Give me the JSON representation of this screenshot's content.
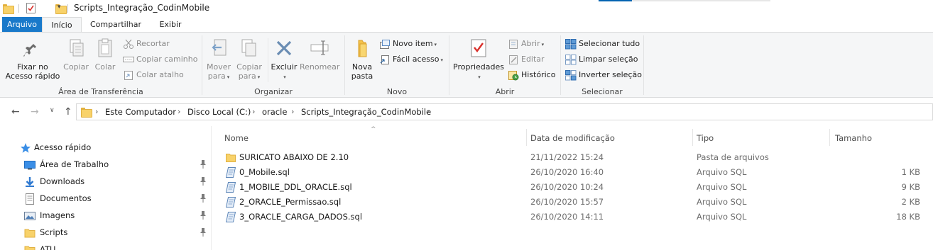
{
  "window": {
    "title": "Scripts_Integração_CodinMobile"
  },
  "ribbon_tabs": [
    {
      "label": "Arquivo"
    },
    {
      "label": "Início"
    },
    {
      "label": "Compartilhar"
    },
    {
      "label": "Exibir"
    }
  ],
  "ribbon": {
    "clipboard": {
      "label": "Área de Transferência",
      "pin_label_1": "Fixar no",
      "pin_label_2": "Acesso rápido",
      "copy": "Copiar",
      "paste": "Colar",
      "cut": "Recortar",
      "copy_path": "Copiar caminho",
      "paste_shortcut": "Colar atalho"
    },
    "organize": {
      "label": "Organizar",
      "move_1": "Mover",
      "move_2": "para",
      "copy_1": "Copiar",
      "copy_2": "para",
      "delete": "Excluir",
      "rename": "Renomear"
    },
    "new": {
      "label": "Novo",
      "new_folder_1": "Nova",
      "new_folder_2": "pasta",
      "new_item": "Novo item",
      "easy_access": "Fácil acesso"
    },
    "open": {
      "label": "Abrir",
      "properties": "Propriedades",
      "open": "Abrir",
      "edit": "Editar",
      "history": "Histórico"
    },
    "select": {
      "label": "Selecionar",
      "select_all": "Selecionar tudo",
      "select_none": "Limpar seleção",
      "invert": "Inverter seleção"
    }
  },
  "address": {
    "crumbs": [
      "Este Computador",
      "Disco Local (C:)",
      "oracle",
      "Scripts_Integração_CodinMobile"
    ]
  },
  "nav_pane": {
    "quick_access": "Acesso rápido",
    "items": [
      {
        "label": "Área de Trabalho",
        "icon": "desktop-icon",
        "pinned": true
      },
      {
        "label": "Downloads",
        "icon": "download-icon",
        "pinned": true
      },
      {
        "label": "Documentos",
        "icon": "documents-icon",
        "pinned": true
      },
      {
        "label": "Imagens",
        "icon": "pictures-icon",
        "pinned": true
      },
      {
        "label": "Scripts",
        "icon": "folder-icon",
        "pinned": true
      },
      {
        "label": "ATU",
        "icon": "folder-icon",
        "pinned": false
      }
    ]
  },
  "columns": {
    "name": "Nome",
    "modified": "Data de modificação",
    "type": "Tipo",
    "size": "Tamanho"
  },
  "files": [
    {
      "name": "SURICATO ABAIXO DE 2.10",
      "modified": "21/11/2022 15:24",
      "type": "Pasta de arquivos",
      "size": "",
      "icon": "folder-icon"
    },
    {
      "name": "0_Mobile.sql",
      "modified": "26/10/2020 16:40",
      "type": "Arquivo SQL",
      "size": "1 KB",
      "icon": "sql-file-icon"
    },
    {
      "name": "1_MOBILE_DDL_ORACLE.sql",
      "modified": "26/10/2020 10:24",
      "type": "Arquivo SQL",
      "size": "9 KB",
      "icon": "sql-file-icon"
    },
    {
      "name": "2_ORACLE_Permissao.sql",
      "modified": "26/10/2020 15:57",
      "type": "Arquivo SQL",
      "size": "2 KB",
      "icon": "sql-file-icon"
    },
    {
      "name": "3_ORACLE_CARGA_DADOS.sql",
      "modified": "26/10/2020 14:11",
      "type": "Arquivo SQL",
      "size": "18 KB",
      "icon": "sql-file-icon"
    }
  ],
  "colors": {
    "accent": "#1979ca",
    "folder": "#f8d26a",
    "ribbon_bg": "#f5f6f7"
  }
}
